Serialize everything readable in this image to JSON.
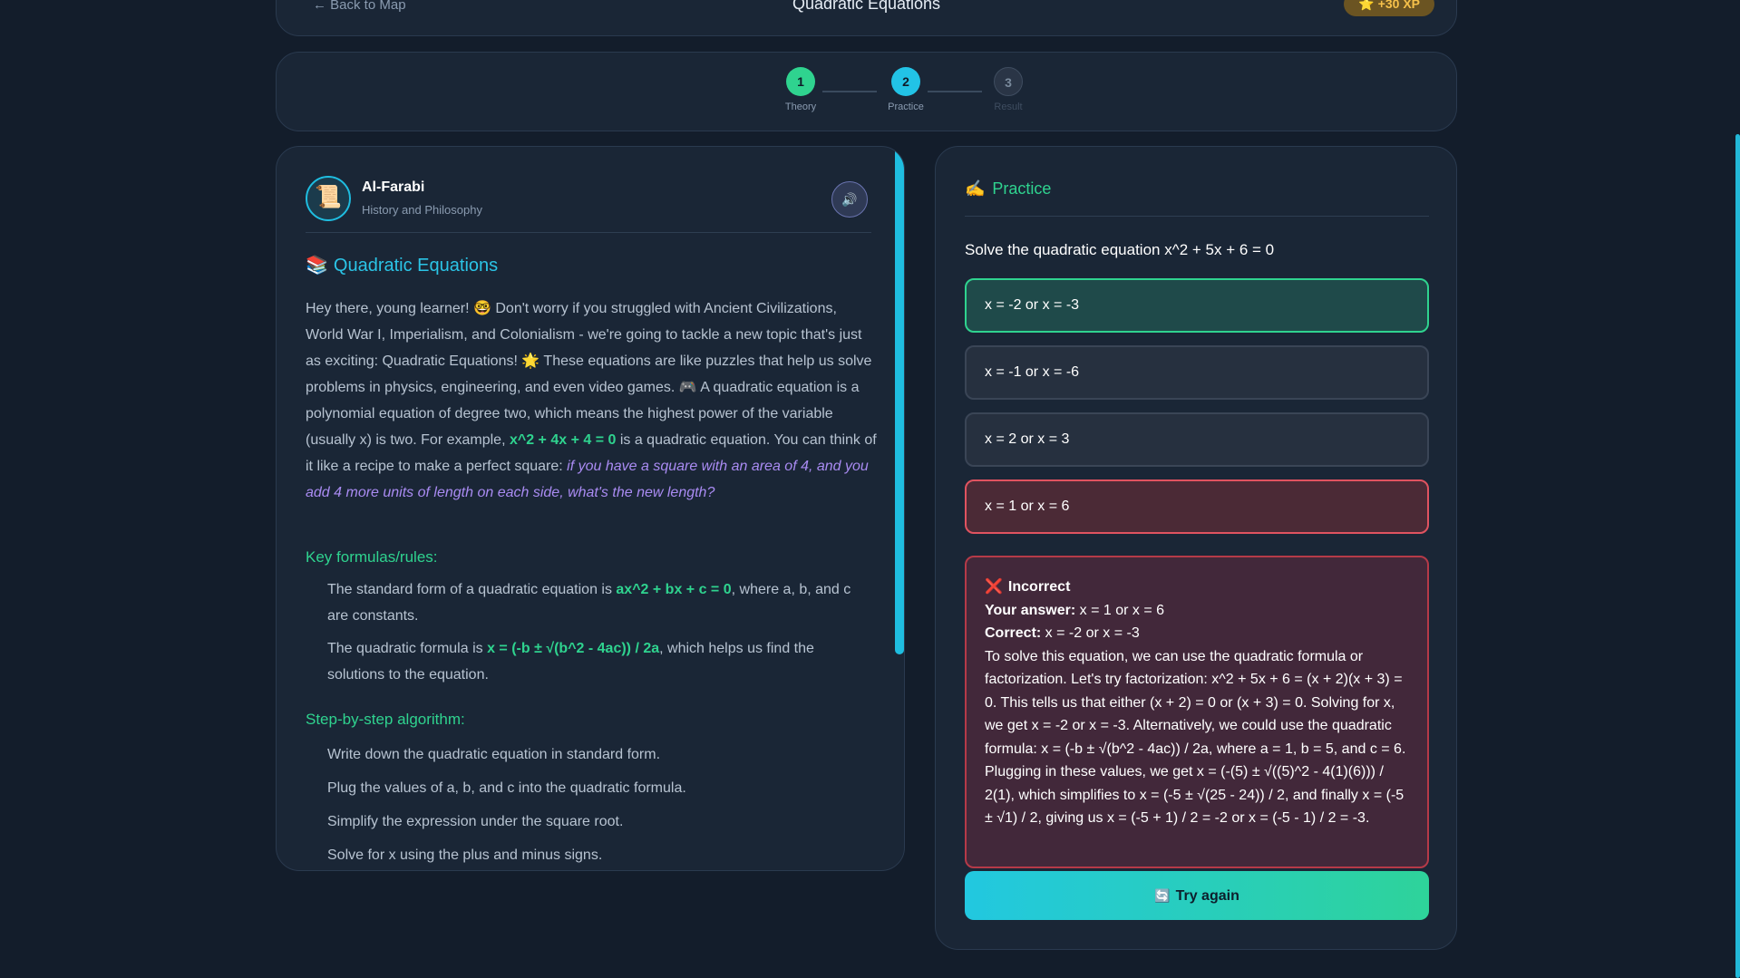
{
  "header": {
    "back_label": "← Back to Map",
    "title": "Quadratic Equations",
    "xp": "⭐ +30 XP"
  },
  "stepper": {
    "steps": [
      {
        "num": "1",
        "label": "Theory",
        "state": "done",
        "color": "#2fd38f"
      },
      {
        "num": "2",
        "label": "Practice",
        "state": "active",
        "color": "#22c3e6"
      },
      {
        "num": "3",
        "label": "Result",
        "state": "pending",
        "color": "#3a4656"
      }
    ]
  },
  "lesson": {
    "teacher_name": "Al-Farabi",
    "teacher_subject": "History and Philosophy",
    "avatar_icon": "📜",
    "audio_icon": "🔊",
    "title_icon": "📚",
    "title": "Quadratic Equations",
    "intro_parts": {
      "p1": "Hey there, young learner! 🤓 Don't worry if you struggled with Ancient Civilizations, World War I, Imperialism, and Colonialism - we're going to tackle a new topic that's just as exciting: Quadratic Equations! 🌟 These equations are like puzzles that help us solve problems in physics, engineering, and even video games. 🎮 A quadratic equation is a polynomial equation of degree two, which means the highest power of the variable (usually x) is two. For example, ",
      "example": "x^2 + 4x + 4 = 0",
      "p2": " is a quadratic equation. You can think of it like a recipe to make a perfect square: ",
      "italic": "if you have a square with an area of 4, and you add 4 more units of length on each side, what's the new length?"
    },
    "formulas_heading": "Key formulas/rules:",
    "formula1": {
      "pre": "The standard form of a quadratic equation is ",
      "hl": "ax^2 + bx + c = 0",
      "post": ", where a, b, and c are constants."
    },
    "formula2": {
      "pre": "The quadratic formula is ",
      "hl": "x = (-b ± √(b^2 - 4ac)) / 2a",
      "post": ", which helps us find the solutions to the equation."
    },
    "algorithm_heading": "Step-by-step algorithm:",
    "algorithm": [
      "Write down the quadratic equation in standard form.",
      "Plug the values of a, b, and c into the quadratic formula.",
      "Simplify the expression under the square root.",
      "Solve for x using the plus and minus signs."
    ]
  },
  "practice": {
    "header_icon": "✍️",
    "header": "Practice",
    "question": "Solve the quadratic equation x^2 + 5x + 6 = 0",
    "options": [
      {
        "label": "x = -2 or x = -3",
        "state": "correct"
      },
      {
        "label": "x = -1 or x = -6",
        "state": "normal"
      },
      {
        "label": "x = 2 or x = 3",
        "state": "normal"
      },
      {
        "label": "x = 1 or x = 6",
        "state": "wrong"
      }
    ],
    "feedback": {
      "icon": "❌",
      "status": "Incorrect",
      "your_answer_label": "Your answer:",
      "your_answer": " x = 1 or x = 6",
      "correct_label": "Correct:",
      "correct": " x = -2 or x = -3",
      "explanation": "To solve this equation, we can use the quadratic formula or factorization. Let's try factorization: x^2 + 5x + 6 = (x + 2)(x + 3) = 0. This tells us that either (x + 2) = 0 or (x + 3) = 0. Solving for x, we get x = -2 or x = -3. Alternatively, we could use the quadratic formula: x = (-b ± √(b^2 - 4ac)) / 2a, where a = 1, b = 5, and c = 6. Plugging in these values, we get x = (-(5) ± √((5)^2 - 4(1)(6))) / 2(1), which simplifies to x = (-5 ± √(25 - 24)) / 2, and finally x = (-5 ± √1) / 2, giving us x = (-5 + 1) / 2 = -2 or x = (-5 - 1) / 2 = -3."
    },
    "try_icon": "🔄",
    "try_again": "Try again"
  }
}
